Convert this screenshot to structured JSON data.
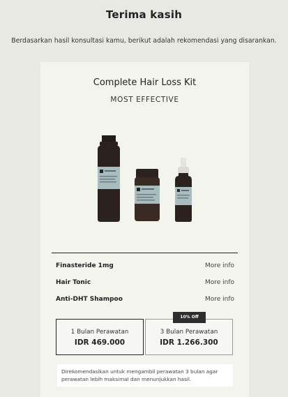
{
  "header": {
    "title": "Terima kasih",
    "subtitle": "Berdasarkan hasil konsultasi kamu, berikut adalah rekomendasi yang disarankan."
  },
  "kit": {
    "name": "Complete Hair Loss Kit",
    "tag": "MOST EFFECTIVE",
    "items": [
      {
        "name": "Finasteride 1mg",
        "more": "More info"
      },
      {
        "name": "Hair Tonic",
        "more": "More info"
      },
      {
        "name": "Anti-DHT Shampoo",
        "more": "More info"
      }
    ]
  },
  "plans": {
    "options": [
      {
        "label": "1 Bulan Perawatan",
        "price": "IDR 469.000",
        "selected": true
      },
      {
        "label": "3 Bulan Perawatan",
        "price": "IDR 1.266.300",
        "selected": false
      }
    ],
    "badge": "10% Off",
    "note": "Direkomendasikan untuk mengambil perawatan 3 bulan agar perawatan lebih maksimal dan menunjukkan hasil."
  },
  "colors": {
    "background": "#e9e9e4",
    "card": "#f4f4ef",
    "bottle_dark": "#2b2220",
    "label_blue": "#a9bcc0"
  }
}
